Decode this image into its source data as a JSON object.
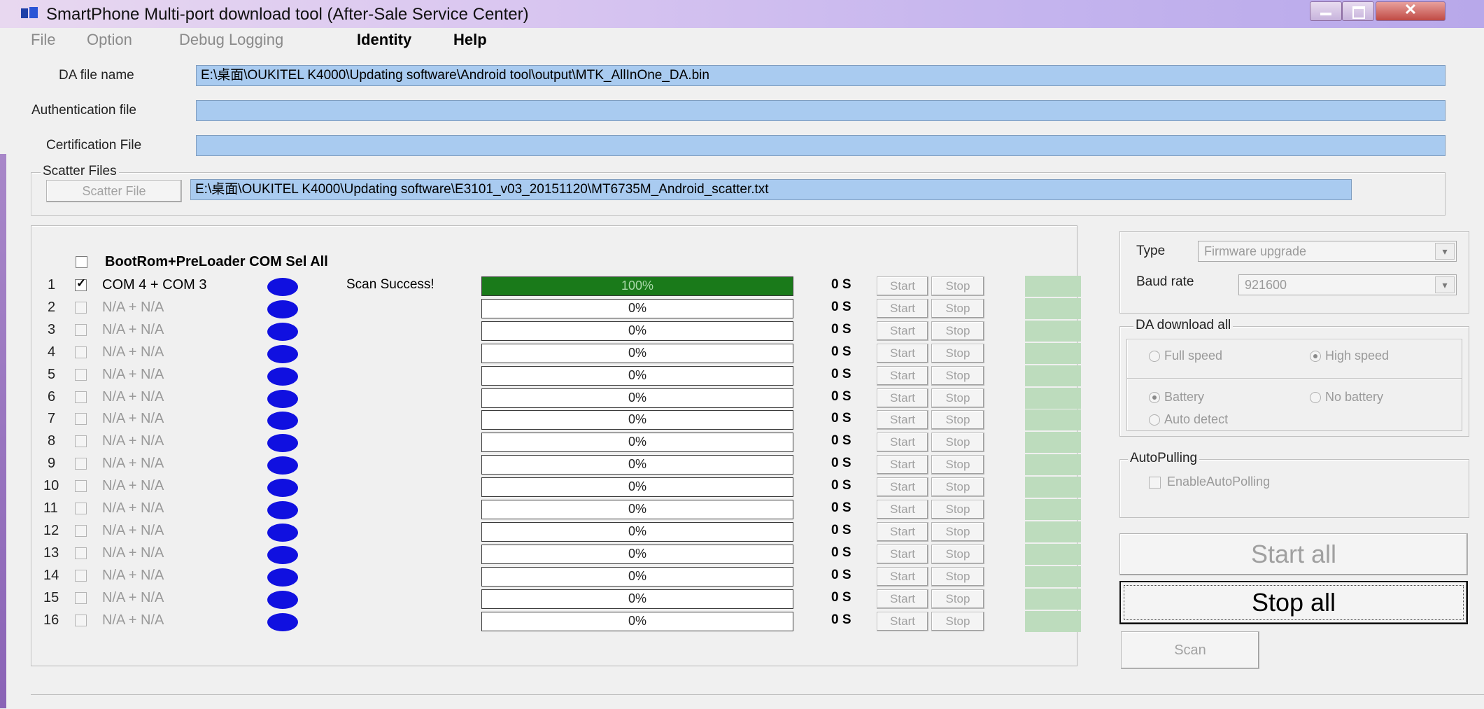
{
  "window": {
    "title": "SmartPhone Multi-port download tool (After-Sale Service Center)",
    "close_glyph": "✕"
  },
  "menu": [
    {
      "label": "File",
      "enabled": false
    },
    {
      "label": "Option",
      "enabled": false
    },
    {
      "label": "Debug Logging",
      "enabled": false
    },
    {
      "label": "Identity",
      "enabled": true
    },
    {
      "label": "Help",
      "enabled": true
    }
  ],
  "files": {
    "da_label": "DA file name",
    "da_value": "E:\\桌面\\OUKITEL K4000\\Updating software\\Android tool\\output\\MTK_AllInOne_DA.bin",
    "auth_label": "Authentication file",
    "auth_value": "",
    "cert_label": "Certification File",
    "cert_value": "",
    "scatter_group": "Scatter Files",
    "scatter_button": "Scatter File",
    "scatter_value": "E:\\桌面\\OUKITEL K4000\\Updating software\\E3101_v03_20151120\\MT6735M_Android_scatter.txt"
  },
  "ports": {
    "select_all_label": "BootRom+PreLoader COM Sel All",
    "start_label": "Start",
    "stop_label": "Stop",
    "rows": [
      {
        "index": "1",
        "name": "COM 4 + COM 3",
        "enabled": true,
        "checked": true,
        "status": "Scan Success!",
        "progress": "100%",
        "progress_value": 100,
        "time": "0 S"
      },
      {
        "index": "2",
        "name": "N/A + N/A",
        "enabled": false,
        "checked": false,
        "status": "",
        "progress": "0%",
        "progress_value": 0,
        "time": "0 S"
      },
      {
        "index": "3",
        "name": "N/A + N/A",
        "enabled": false,
        "checked": false,
        "status": "",
        "progress": "0%",
        "progress_value": 0,
        "time": "0 S"
      },
      {
        "index": "4",
        "name": "N/A + N/A",
        "enabled": false,
        "checked": false,
        "status": "",
        "progress": "0%",
        "progress_value": 0,
        "time": "0 S"
      },
      {
        "index": "5",
        "name": "N/A + N/A",
        "enabled": false,
        "checked": false,
        "status": "",
        "progress": "0%",
        "progress_value": 0,
        "time": "0 S"
      },
      {
        "index": "6",
        "name": "N/A + N/A",
        "enabled": false,
        "checked": false,
        "status": "",
        "progress": "0%",
        "progress_value": 0,
        "time": "0 S"
      },
      {
        "index": "7",
        "name": "N/A + N/A",
        "enabled": false,
        "checked": false,
        "status": "",
        "progress": "0%",
        "progress_value": 0,
        "time": "0 S"
      },
      {
        "index": "8",
        "name": "N/A + N/A",
        "enabled": false,
        "checked": false,
        "status": "",
        "progress": "0%",
        "progress_value": 0,
        "time": "0 S"
      },
      {
        "index": "9",
        "name": "N/A + N/A",
        "enabled": false,
        "checked": false,
        "status": "",
        "progress": "0%",
        "progress_value": 0,
        "time": "0 S"
      },
      {
        "index": "10",
        "name": "N/A + N/A",
        "enabled": false,
        "checked": false,
        "status": "",
        "progress": "0%",
        "progress_value": 0,
        "time": "0 S"
      },
      {
        "index": "11",
        "name": "N/A + N/A",
        "enabled": false,
        "checked": false,
        "status": "",
        "progress": "0%",
        "progress_value": 0,
        "time": "0 S"
      },
      {
        "index": "12",
        "name": "N/A + N/A",
        "enabled": false,
        "checked": false,
        "status": "",
        "progress": "0%",
        "progress_value": 0,
        "time": "0 S"
      },
      {
        "index": "13",
        "name": "N/A + N/A",
        "enabled": false,
        "checked": false,
        "status": "",
        "progress": "0%",
        "progress_value": 0,
        "time": "0 S"
      },
      {
        "index": "14",
        "name": "N/A + N/A",
        "enabled": false,
        "checked": false,
        "status": "",
        "progress": "0%",
        "progress_value": 0,
        "time": "0 S"
      },
      {
        "index": "15",
        "name": "N/A + N/A",
        "enabled": false,
        "checked": false,
        "status": "",
        "progress": "0%",
        "progress_value": 0,
        "time": "0 S"
      },
      {
        "index": "16",
        "name": "N/A + N/A",
        "enabled": false,
        "checked": false,
        "status": "",
        "progress": "0%",
        "progress_value": 0,
        "time": "0 S"
      }
    ]
  },
  "settings": {
    "type_label": "Type",
    "type_value": "Firmware upgrade",
    "baud_label": "Baud rate",
    "baud_value": "921600",
    "da_group": "DA download all",
    "full_speed": "Full speed",
    "high_speed": "High speed",
    "speed_selected": "High speed",
    "battery": "Battery",
    "no_battery": "No battery",
    "auto_detect": "Auto detect",
    "battery_selected": "Battery",
    "autopulling_group": "AutoPulling",
    "enable_autopolling": "EnableAutoPolling",
    "enable_autopolling_checked": false
  },
  "actions": {
    "start_all": "Start all",
    "stop_all": "Stop all",
    "scan": "Scan"
  },
  "colors": {
    "port_indicator": "#1010e0",
    "progress_done": "#1a7a1a",
    "path_field": "#a9cbf0",
    "port_led": "#bddcbd"
  }
}
